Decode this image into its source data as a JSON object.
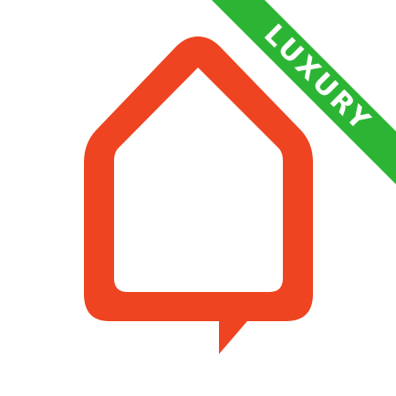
{
  "app_icon": {
    "logo_icon": "house-speech-bubble-icon",
    "logo_color": "#EE4421",
    "background_color": "#FFFFFF",
    "ribbon": {
      "label": "LUXURY",
      "color": "#2CB534",
      "text_color": "#FFFFFF"
    }
  }
}
